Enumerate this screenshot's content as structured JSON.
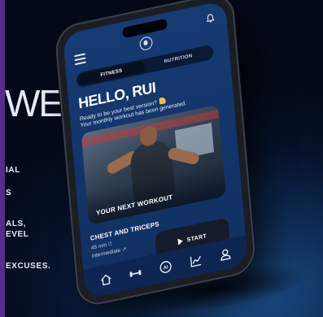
{
  "background": {
    "headline_fragment": "WER",
    "lines": [
      "IAL",
      "S",
      "ALS,",
      "EVEL",
      "EXCUSES."
    ],
    "accent_color": "#5a2a8c"
  },
  "app": {
    "header": {
      "menu_icon": "menu-icon",
      "logo_icon": "apple-logo-icon",
      "bell_icon": "bell-icon"
    },
    "tabs": [
      {
        "label": "FITNESS",
        "active": true
      },
      {
        "label": "NUTRITION",
        "active": false
      }
    ],
    "greeting": "HELLO, RUI",
    "subtitle_line1": "Ready to be your best version?",
    "subtitle_line2": "Your monthly workout has been generated.",
    "card": {
      "label": "YOUR NEXT WORKOUT"
    },
    "workout": {
      "title": "CHEST AND TRICEPS",
      "duration": "45 min",
      "level": "Intermediate"
    },
    "start_button": {
      "label": "START"
    },
    "bottom_nav": [
      {
        "icon": "home-icon"
      },
      {
        "icon": "dumbbell-icon"
      },
      {
        "icon": "ai-icon"
      },
      {
        "icon": "chart-icon"
      },
      {
        "icon": "profile-icon"
      }
    ],
    "colors": {
      "screen": "#173a73",
      "tab_bg": "#0a1a36",
      "button_bg": "#141b2a",
      "nav_bg": "#0e2552"
    }
  }
}
